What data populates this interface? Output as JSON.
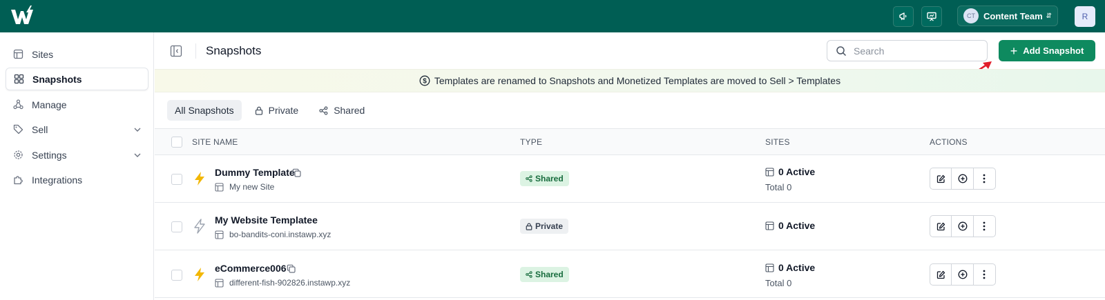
{
  "topbar": {
    "logo_icon": "instawp-logo-icon",
    "announce_icon": "megaphone-icon",
    "presentation_icon": "presentation-icon",
    "team_initials": "CT",
    "team_name": "Content Team",
    "user_initial": "R",
    "colors": {
      "bg": "#005e54"
    }
  },
  "sidebar": {
    "items": [
      {
        "label": "Sites",
        "icon": "layout-icon"
      },
      {
        "label": "Snapshots",
        "icon": "grid-icon",
        "active": true
      },
      {
        "label": "Manage",
        "icon": "share-nodes-icon"
      },
      {
        "label": "Sell",
        "icon": "tag-icon",
        "has_chevron": true
      },
      {
        "label": "Settings",
        "icon": "gear-icon",
        "has_chevron": true
      },
      {
        "label": "Integrations",
        "icon": "puzzle-icon"
      }
    ]
  },
  "header": {
    "title": "Snapshots",
    "search_placeholder": "Search",
    "add_button": "Add Snapshot",
    "accent": "#0e8a5f"
  },
  "banner": {
    "text": "Templates are renamed to Snapshots and Monetized Templates are moved to Sell > Templates"
  },
  "tabs": [
    {
      "label": "All Snapshots",
      "active": true
    },
    {
      "label": "Private",
      "icon": "lock-icon"
    },
    {
      "label": "Shared",
      "icon": "share-icon"
    }
  ],
  "table": {
    "columns": [
      "SITE NAME",
      "TYPE",
      "SITES",
      "ACTIONS"
    ],
    "rows": [
      {
        "name": "Dummy Template",
        "url": "My new Site",
        "type": "Shared",
        "active": "0 Active",
        "total": "Total 0",
        "bolt": "filled"
      },
      {
        "name": "My Website Templatee",
        "url": "bo-bandits-coni.instawp.xyz",
        "type": "Private",
        "active": "0 Active",
        "total": "",
        "bolt": "outline"
      },
      {
        "name": "eCommerce006",
        "url": "different-fish-902826.instawp.xyz",
        "type": "Shared",
        "active": "0 Active",
        "total": "Total 0",
        "bolt": "filled"
      }
    ]
  }
}
